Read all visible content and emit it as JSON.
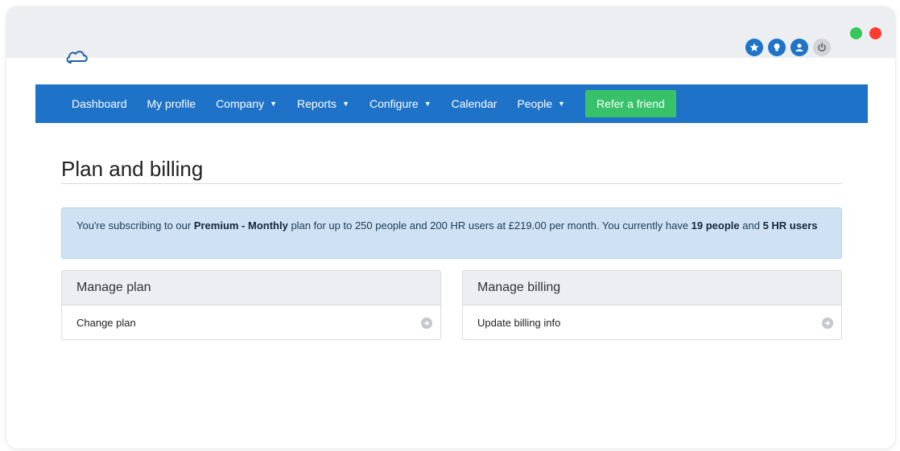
{
  "window": {
    "traffic_colors": [
      "#34c759",
      "#ff3b30"
    ]
  },
  "header": {
    "logo_icon": "cloud-icon",
    "top_icons": [
      "star-icon",
      "lightbulb-icon",
      "user-icon",
      "power-icon"
    ]
  },
  "nav": {
    "items": [
      {
        "label": "Dashboard",
        "dropdown": false
      },
      {
        "label": "My profile",
        "dropdown": false
      },
      {
        "label": "Company",
        "dropdown": true
      },
      {
        "label": "Reports",
        "dropdown": true
      },
      {
        "label": "Configure",
        "dropdown": true
      },
      {
        "label": "Calendar",
        "dropdown": false
      },
      {
        "label": "People",
        "dropdown": true
      }
    ],
    "refer_label": "Refer a friend",
    "bar_color": "#1e73c8",
    "refer_color": "#37c26a"
  },
  "main": {
    "title": "Plan and billing",
    "alert": {
      "prefix": "You're subscribing to our ",
      "plan_name": "Premium - Monthly",
      "middle": " plan for up to 250 people and 200 HR users at £219.00 per month. You currently have ",
      "people_count": "19 people",
      "and_text": " and ",
      "hr_count": "5 HR users"
    },
    "panels": [
      {
        "heading": "Manage plan",
        "row_label": "Change plan"
      },
      {
        "heading": "Manage billing",
        "row_label": "Update billing info"
      }
    ]
  }
}
